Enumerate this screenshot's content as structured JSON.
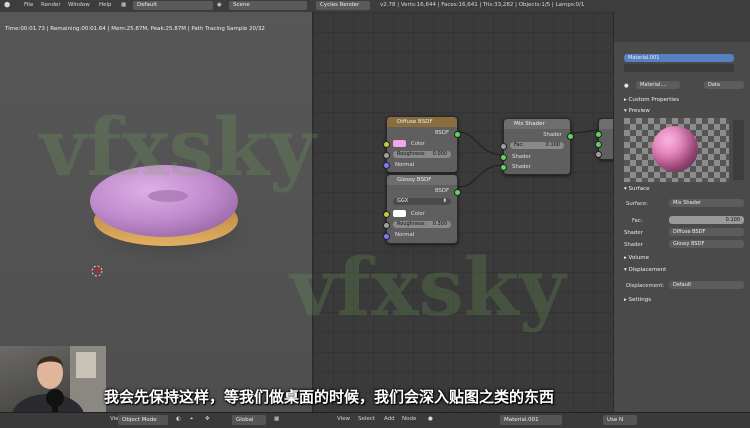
{
  "topbar": {
    "menus": [
      "File",
      "Render",
      "Window",
      "Help"
    ],
    "screen_layout": "Default",
    "scene": "Scene",
    "render_engine": "Cycles Render",
    "stats": "v2.78 | Verts:16,644 | Faces:16,641 | Tris:33,282 | Objects:1/5 | Lamps:0/1"
  },
  "viewport": {
    "render_status": "Time:00:01.73 | Remaining:00:01.64 | Mem:25.87M, Peak:25.87M | Path Tracing Sample 20/32"
  },
  "nodes": {
    "diffuse": {
      "title": "Diffuse BSDF",
      "output": "BSDF",
      "color_label": "Color",
      "color_value": "#f2a6e6",
      "roughness_label": "Roughness:",
      "roughness_value": "0.000",
      "normal_label": "Normal"
    },
    "glossy": {
      "title": "Glossy BSDF",
      "output": "BSDF",
      "distribution": "GGX",
      "color_label": "Color",
      "color_value": "#ffffff",
      "roughness_label": "Roughness:",
      "roughness_value": "0.300",
      "normal_label": "Normal"
    },
    "mix": {
      "title": "Mix Shader",
      "output": "Shader",
      "fac_label": "Fac:",
      "fac_value": "0.100",
      "shader1": "Shader",
      "shader2": "Shader"
    }
  },
  "properties": {
    "material_slot": "Material.001",
    "material_name": "Material....",
    "data_dropdown": "Data",
    "sections": {
      "custom_properties": "Custom Properties",
      "preview": "Preview",
      "surface": "Surface",
      "volume": "Volume",
      "displacement": "Displacement",
      "settings": "Settings"
    },
    "surface_label": "Surface:",
    "surface_value": "Mix Shader",
    "fac_label": "Fac:",
    "fac_value": "0.100",
    "shader1_label": "Shader",
    "shader1_value": "Diffuse BSDF",
    "shader2_label": "Shader",
    "shader2_value": "Glossy BSDF",
    "displacement_label": "Displacement:",
    "displacement_value": "Default",
    "preview_sphere_color": "#e06fb0"
  },
  "bottombar": {
    "view": "View",
    "object_mode": "Object Mode",
    "orientation": "Global",
    "node_menus": [
      "View",
      "Select",
      "Add",
      "Node"
    ],
    "material_field": "Material.001",
    "use_nodes": "Use N"
  },
  "overlay": {
    "subtitle": "我会先保持这样，等我们做桌面的时候，我们会深入贴图之类的东西",
    "watermark": "vfxsky"
  },
  "colors": {
    "donut": "#c48fd0",
    "icing_highlight": "#d8a6e0",
    "dough": "#d9a24f",
    "socket_green": "#5ed55e",
    "socket_yellow": "#c8c838",
    "socket_blue": "#7a7aff"
  }
}
